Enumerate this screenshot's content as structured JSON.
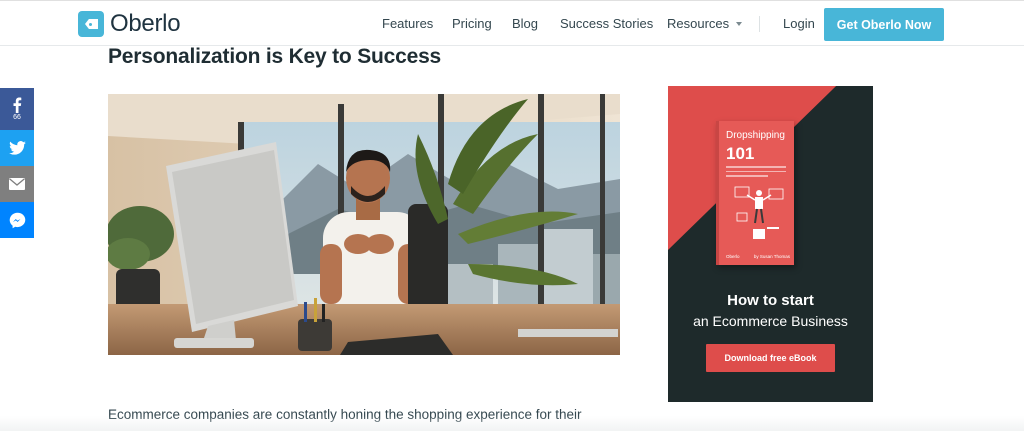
{
  "header": {
    "logo_text": "Oberlo",
    "nav": {
      "features": "Features",
      "pricing": "Pricing",
      "blog": "Blog",
      "success_stories": "Success Stories",
      "resources": "Resources",
      "login": "Login"
    },
    "cta_label": "Get Oberlo Now"
  },
  "share": {
    "facebook_count": "66",
    "icons": [
      "facebook-icon",
      "twitter-icon",
      "email-icon",
      "messenger-icon"
    ]
  },
  "article": {
    "title": "Personalization is Key to Success",
    "body_start": "Ecommerce companies are constantly honing the shopping experience for their"
  },
  "ad": {
    "book_title": "Dropshipping",
    "book_number": "101",
    "book_brand": "Oberlo",
    "book_author": "by Susan Thomas",
    "headline": "How to start",
    "subheadline": "an Ecommerce Business",
    "button_label": "Download free eBook"
  },
  "colors": {
    "brand_blue": "#48b6d8",
    "ad_red": "#de4d4b",
    "ad_dark": "#1e2a2b",
    "facebook": "#3b5998",
    "twitter": "#1da1f2",
    "email": "#7f7f7f",
    "messenger": "#0084ff"
  }
}
